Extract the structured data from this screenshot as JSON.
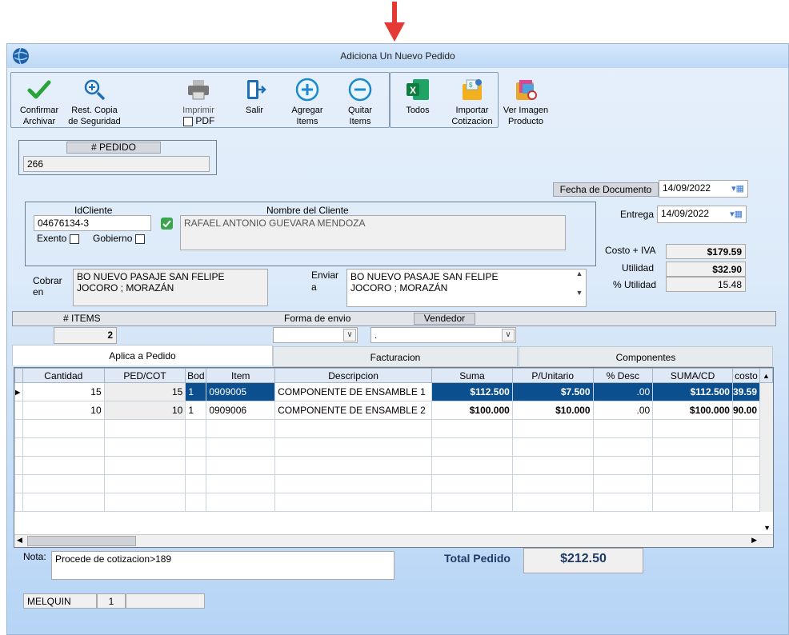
{
  "window": {
    "title": "Adiciona Un Nuevo Pedido"
  },
  "toolbar": {
    "confirm": "Confirmar\nArchivar",
    "restore": "Rest. Copia\nde Seguridad",
    "print": "Imprimir",
    "pdf": "PDF",
    "exit": "Salir",
    "add": "Agregar\nItems",
    "remove": "Quitar\nItems",
    "all": "Todos",
    "import": "Importar\nCotizacion",
    "view_image": "Ver Imagen\nProducto"
  },
  "order": {
    "label": "# PEDIDO",
    "value": "266"
  },
  "doc_date": {
    "label": "Fecha de  Documento",
    "value": "14/09/2022"
  },
  "delivery": {
    "label": "Entrega",
    "value": "14/09/2022"
  },
  "client": {
    "id_label": "IdCliente",
    "id_value": "04676134-3",
    "name_label": "Nombre del Cliente",
    "name_value": "RAFAEL ANTONIO GUEVARA MENDOZA",
    "exempt_label": "Exento",
    "gov_label": "Gobierno"
  },
  "totals_side": {
    "cost_label": "Costo + IVA",
    "cost_value": "$179.59",
    "util_label": "Utilidad",
    "util_value": "$32.90",
    "pct_label": "% Utilidad",
    "pct_value": "15.48"
  },
  "billing": {
    "label": "Cobrar\nen",
    "value": "BO NUEVO PASAJE SAN FELIPE\nJOCORO ; MORAZÁN"
  },
  "shipping": {
    "label": "Enviar\na",
    "value": "BO NUEVO PASAJE SAN FELIPE\nJOCORO ; MORAZÁN"
  },
  "items_bar": {
    "items_label": "# ITEMS",
    "ship_label": "Forma de envio",
    "seller_label": "Vendedor",
    "items_value": "2",
    "seller_value": "."
  },
  "tabs": [
    "Aplica a Pedido",
    "Facturacion",
    "Componentes"
  ],
  "table": {
    "columns": [
      "Cantidad",
      "PED/COT",
      "Bod",
      "Item",
      "Descripcion",
      "Suma",
      "P/Unitario",
      "% Desc",
      "SUMA/CD",
      "costo"
    ],
    "rows": [
      [
        "15",
        "15",
        "1",
        "0909005",
        "COMPONENTE DE ENSAMBLE 1",
        "$112.500",
        "$7.500",
        ".00",
        "$112.500",
        "39.59"
      ],
      [
        "10",
        "10",
        "1",
        "0909006",
        "COMPONENTE DE ENSAMBLE 2",
        "$100.000",
        "$10.000",
        ".00",
        "$100.000",
        "90.00"
      ]
    ]
  },
  "note": {
    "label": "Nota:",
    "value": "Procede de cotizacion>189"
  },
  "total": {
    "label": "Total Pedido",
    "value": "$212.50"
  },
  "status": {
    "user": "MELQUIN",
    "num": "1"
  },
  "colors": {
    "selected_row": "#0b4f8f",
    "window_bg": "#dceaf9",
    "arrow": "#e53935"
  }
}
